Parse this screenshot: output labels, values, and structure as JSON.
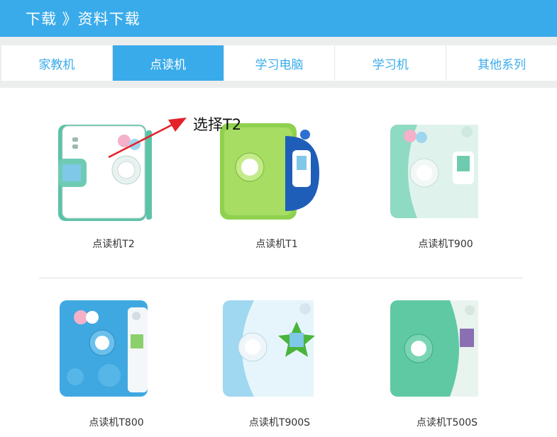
{
  "header": {
    "breadcrumb": "下载 》资料下载"
  },
  "tabs": [
    {
      "label": "家教机",
      "active": false
    },
    {
      "label": "点读机",
      "active": true
    },
    {
      "label": "学习电脑",
      "active": false
    },
    {
      "label": "学习机",
      "active": false
    },
    {
      "label": "其他系列",
      "active": false
    }
  ],
  "annotation": {
    "text": "选择T2",
    "color": "#e3212a"
  },
  "products": [
    {
      "name": "点读机T2"
    },
    {
      "name": "点读机T1"
    },
    {
      "name": "点读机T900"
    },
    {
      "name": "点读机T800"
    },
    {
      "name": "点读机T900S"
    },
    {
      "name": "点读机T500S"
    }
  ],
  "colors": {
    "accent": "#3aabea"
  }
}
